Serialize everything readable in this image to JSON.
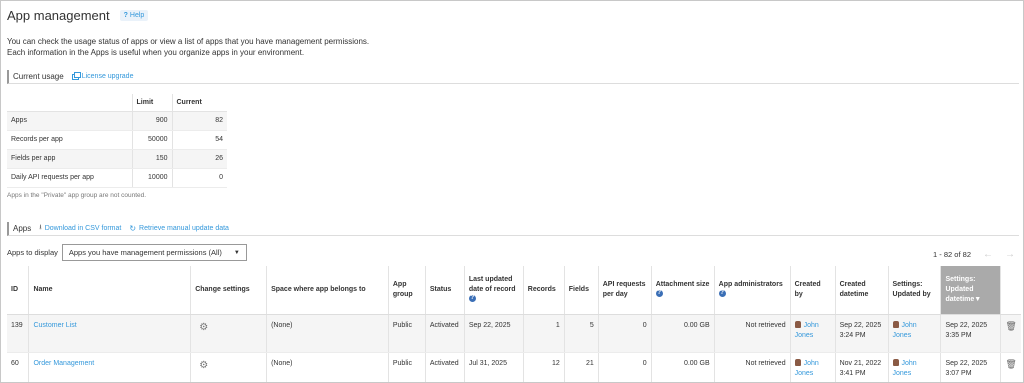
{
  "header": {
    "title": "App management",
    "help_label": "Help"
  },
  "description": {
    "line1": "You can check the usage status of apps or view a list of apps that you have management permissions.",
    "line2": "Each information in the Apps is useful when you organize apps in your environment."
  },
  "current_usage": {
    "title": "Current usage",
    "license_link": "License upgrade",
    "col_limit": "Limit",
    "col_current": "Current",
    "rows": [
      {
        "label": "Apps",
        "limit": "900",
        "current": "82"
      },
      {
        "label": "Records per app",
        "limit": "50000",
        "current": "54"
      },
      {
        "label": "Fields per app",
        "limit": "150",
        "current": "26"
      },
      {
        "label": "Daily API requests per app",
        "limit": "10000",
        "current": "0"
      }
    ],
    "note": "Apps in the \"Private\" app group are not counted."
  },
  "apps_section": {
    "title": "Apps",
    "download_link": "Download in CSV format",
    "retrieve_link": "Retrieve manual update data",
    "filter_label": "Apps to display",
    "filter_value": "Apps you have management permissions (All)",
    "pager_text": "1 - 82 of 82"
  },
  "table": {
    "headers": {
      "id": "ID",
      "name": "Name",
      "change_settings": "Change settings",
      "space": "Space where app belongs to",
      "app_group": "App group",
      "status": "Status",
      "last_updated": "Last updated date of record",
      "records": "Records",
      "fields": "Fields",
      "api_requests": "API requests per day",
      "attachment": "Attachment size",
      "admins": "App administrators",
      "created_by": "Created by",
      "created_datetime": "Created datetime",
      "settings_updated_by": "Settings: Updated by",
      "settings_updated_datetime": "Settings: Updated datetime"
    },
    "rows": [
      {
        "id": "139",
        "name": "Customer List",
        "space": "(None)",
        "app_group": "Public",
        "status": "Activated",
        "last_updated": "Sep 22, 2025",
        "records": "1",
        "fields": "5",
        "api_requests": "0",
        "attachment": "0.00 GB",
        "admins": "Not retrieved",
        "created_by": "John Jones",
        "created_datetime": "Sep 22, 2025 3:24 PM",
        "updated_by": "John Jones",
        "updated_datetime": "Sep 22, 2025 3:35 PM"
      },
      {
        "id": "60",
        "name": "Order Management",
        "space": "(None)",
        "app_group": "Public",
        "status": "Activated",
        "last_updated": "Jul 31, 2025",
        "records": "12",
        "fields": "21",
        "api_requests": "0",
        "attachment": "0.00 GB",
        "admins": "Not retrieved",
        "created_by": "John Jones",
        "created_datetime": "Nov 21, 2022 3:41 PM",
        "updated_by": "John Jones",
        "updated_datetime": "Sep 22, 2025 3:07 PM"
      }
    ]
  },
  "icons": {
    "help": "question-icon",
    "license": "window-icon",
    "download": "download-icon",
    "retrieve": "refresh-icon",
    "gear": "gear-icon",
    "trash": "trash-icon",
    "avatar": "avatar-icon"
  },
  "colors": {
    "link": "#3498db",
    "sorted_header": "#aaaaaa"
  }
}
